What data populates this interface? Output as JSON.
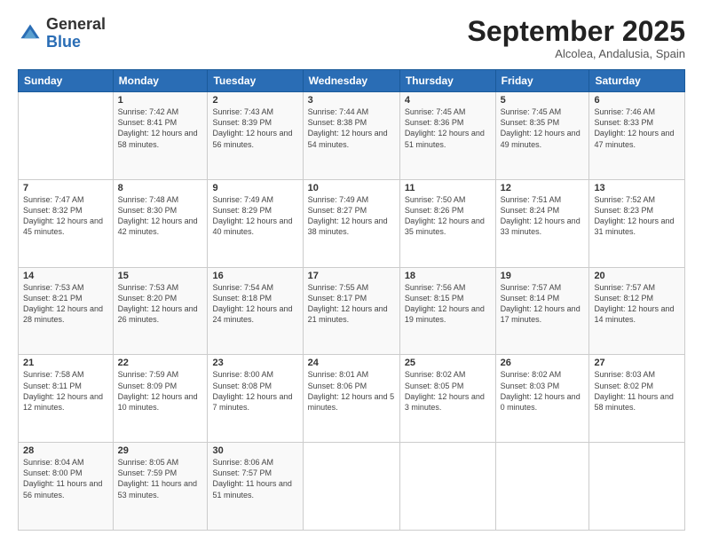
{
  "header": {
    "logo_general": "General",
    "logo_blue": "Blue",
    "month_title": "September 2025",
    "location": "Alcolea, Andalusia, Spain"
  },
  "days_of_week": [
    "Sunday",
    "Monday",
    "Tuesday",
    "Wednesday",
    "Thursday",
    "Friday",
    "Saturday"
  ],
  "weeks": [
    [
      {
        "day": "",
        "sunrise": "",
        "sunset": "",
        "daylight": ""
      },
      {
        "day": "1",
        "sunrise": "Sunrise: 7:42 AM",
        "sunset": "Sunset: 8:41 PM",
        "daylight": "Daylight: 12 hours and 58 minutes."
      },
      {
        "day": "2",
        "sunrise": "Sunrise: 7:43 AM",
        "sunset": "Sunset: 8:39 PM",
        "daylight": "Daylight: 12 hours and 56 minutes."
      },
      {
        "day": "3",
        "sunrise": "Sunrise: 7:44 AM",
        "sunset": "Sunset: 8:38 PM",
        "daylight": "Daylight: 12 hours and 54 minutes."
      },
      {
        "day": "4",
        "sunrise": "Sunrise: 7:45 AM",
        "sunset": "Sunset: 8:36 PM",
        "daylight": "Daylight: 12 hours and 51 minutes."
      },
      {
        "day": "5",
        "sunrise": "Sunrise: 7:45 AM",
        "sunset": "Sunset: 8:35 PM",
        "daylight": "Daylight: 12 hours and 49 minutes."
      },
      {
        "day": "6",
        "sunrise": "Sunrise: 7:46 AM",
        "sunset": "Sunset: 8:33 PM",
        "daylight": "Daylight: 12 hours and 47 minutes."
      }
    ],
    [
      {
        "day": "7",
        "sunrise": "Sunrise: 7:47 AM",
        "sunset": "Sunset: 8:32 PM",
        "daylight": "Daylight: 12 hours and 45 minutes."
      },
      {
        "day": "8",
        "sunrise": "Sunrise: 7:48 AM",
        "sunset": "Sunset: 8:30 PM",
        "daylight": "Daylight: 12 hours and 42 minutes."
      },
      {
        "day": "9",
        "sunrise": "Sunrise: 7:49 AM",
        "sunset": "Sunset: 8:29 PM",
        "daylight": "Daylight: 12 hours and 40 minutes."
      },
      {
        "day": "10",
        "sunrise": "Sunrise: 7:49 AM",
        "sunset": "Sunset: 8:27 PM",
        "daylight": "Daylight: 12 hours and 38 minutes."
      },
      {
        "day": "11",
        "sunrise": "Sunrise: 7:50 AM",
        "sunset": "Sunset: 8:26 PM",
        "daylight": "Daylight: 12 hours and 35 minutes."
      },
      {
        "day": "12",
        "sunrise": "Sunrise: 7:51 AM",
        "sunset": "Sunset: 8:24 PM",
        "daylight": "Daylight: 12 hours and 33 minutes."
      },
      {
        "day": "13",
        "sunrise": "Sunrise: 7:52 AM",
        "sunset": "Sunset: 8:23 PM",
        "daylight": "Daylight: 12 hours and 31 minutes."
      }
    ],
    [
      {
        "day": "14",
        "sunrise": "Sunrise: 7:53 AM",
        "sunset": "Sunset: 8:21 PM",
        "daylight": "Daylight: 12 hours and 28 minutes."
      },
      {
        "day": "15",
        "sunrise": "Sunrise: 7:53 AM",
        "sunset": "Sunset: 8:20 PM",
        "daylight": "Daylight: 12 hours and 26 minutes."
      },
      {
        "day": "16",
        "sunrise": "Sunrise: 7:54 AM",
        "sunset": "Sunset: 8:18 PM",
        "daylight": "Daylight: 12 hours and 24 minutes."
      },
      {
        "day": "17",
        "sunrise": "Sunrise: 7:55 AM",
        "sunset": "Sunset: 8:17 PM",
        "daylight": "Daylight: 12 hours and 21 minutes."
      },
      {
        "day": "18",
        "sunrise": "Sunrise: 7:56 AM",
        "sunset": "Sunset: 8:15 PM",
        "daylight": "Daylight: 12 hours and 19 minutes."
      },
      {
        "day": "19",
        "sunrise": "Sunrise: 7:57 AM",
        "sunset": "Sunset: 8:14 PM",
        "daylight": "Daylight: 12 hours and 17 minutes."
      },
      {
        "day": "20",
        "sunrise": "Sunrise: 7:57 AM",
        "sunset": "Sunset: 8:12 PM",
        "daylight": "Daylight: 12 hours and 14 minutes."
      }
    ],
    [
      {
        "day": "21",
        "sunrise": "Sunrise: 7:58 AM",
        "sunset": "Sunset: 8:11 PM",
        "daylight": "Daylight: 12 hours and 12 minutes."
      },
      {
        "day": "22",
        "sunrise": "Sunrise: 7:59 AM",
        "sunset": "Sunset: 8:09 PM",
        "daylight": "Daylight: 12 hours and 10 minutes."
      },
      {
        "day": "23",
        "sunrise": "Sunrise: 8:00 AM",
        "sunset": "Sunset: 8:08 PM",
        "daylight": "Daylight: 12 hours and 7 minutes."
      },
      {
        "day": "24",
        "sunrise": "Sunrise: 8:01 AM",
        "sunset": "Sunset: 8:06 PM",
        "daylight": "Daylight: 12 hours and 5 minutes."
      },
      {
        "day": "25",
        "sunrise": "Sunrise: 8:02 AM",
        "sunset": "Sunset: 8:05 PM",
        "daylight": "Daylight: 12 hours and 3 minutes."
      },
      {
        "day": "26",
        "sunrise": "Sunrise: 8:02 AM",
        "sunset": "Sunset: 8:03 PM",
        "daylight": "Daylight: 12 hours and 0 minutes."
      },
      {
        "day": "27",
        "sunrise": "Sunrise: 8:03 AM",
        "sunset": "Sunset: 8:02 PM",
        "daylight": "Daylight: 11 hours and 58 minutes."
      }
    ],
    [
      {
        "day": "28",
        "sunrise": "Sunrise: 8:04 AM",
        "sunset": "Sunset: 8:00 PM",
        "daylight": "Daylight: 11 hours and 56 minutes."
      },
      {
        "day": "29",
        "sunrise": "Sunrise: 8:05 AM",
        "sunset": "Sunset: 7:59 PM",
        "daylight": "Daylight: 11 hours and 53 minutes."
      },
      {
        "day": "30",
        "sunrise": "Sunrise: 8:06 AM",
        "sunset": "Sunset: 7:57 PM",
        "daylight": "Daylight: 11 hours and 51 minutes."
      },
      {
        "day": "",
        "sunrise": "",
        "sunset": "",
        "daylight": ""
      },
      {
        "day": "",
        "sunrise": "",
        "sunset": "",
        "daylight": ""
      },
      {
        "day": "",
        "sunrise": "",
        "sunset": "",
        "daylight": ""
      },
      {
        "day": "",
        "sunrise": "",
        "sunset": "",
        "daylight": ""
      }
    ]
  ]
}
